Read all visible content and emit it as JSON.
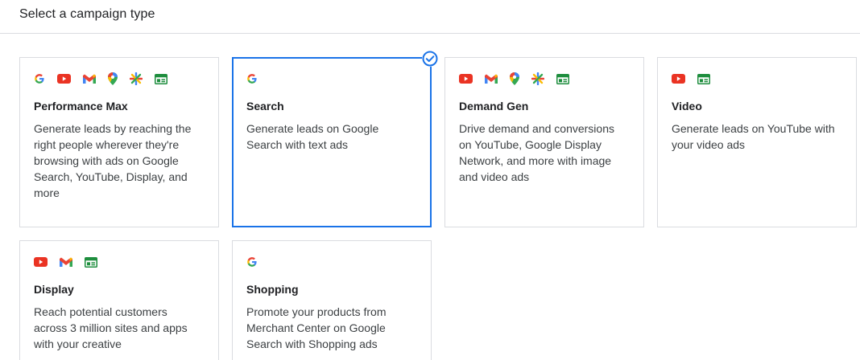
{
  "header": {
    "title": "Select a campaign type"
  },
  "campaigns": [
    {
      "title": "Performance Max",
      "description": "Generate leads by reaching the right people wherever they're browsing with ads on Google Search, YouTube, Display, and more",
      "icons": [
        "google-icon",
        "youtube-icon",
        "gmail-icon",
        "maps-icon",
        "discover-icon",
        "display-icon"
      ],
      "selected": false
    },
    {
      "title": "Search",
      "description": "Generate leads on Google Search with text ads",
      "icons": [
        "google-icon"
      ],
      "selected": true
    },
    {
      "title": "Demand Gen",
      "description": "Drive demand and conversions on YouTube, Google Display Network, and more with image and video ads",
      "icons": [
        "youtube-icon",
        "gmail-icon",
        "maps-icon",
        "discover-icon",
        "display-icon"
      ],
      "selected": false
    },
    {
      "title": "Video",
      "description": "Generate leads on YouTube with your video ads",
      "icons": [
        "youtube-icon",
        "display-icon"
      ],
      "selected": false
    },
    {
      "title": "Display",
      "description": "Reach potential customers across 3 million sites and apps with your creative",
      "icons": [
        "youtube-icon",
        "gmail-icon",
        "display-icon"
      ],
      "selected": false
    },
    {
      "title": "Shopping",
      "description": "Promote your products from Merchant Center on Google Search with Shopping ads",
      "icons": [
        "google-icon"
      ],
      "selected": false
    }
  ],
  "colors": {
    "accent": "#1a73e8",
    "border": "#dadce0",
    "youtube": "#ea3323",
    "display": "#1e8e3e"
  }
}
